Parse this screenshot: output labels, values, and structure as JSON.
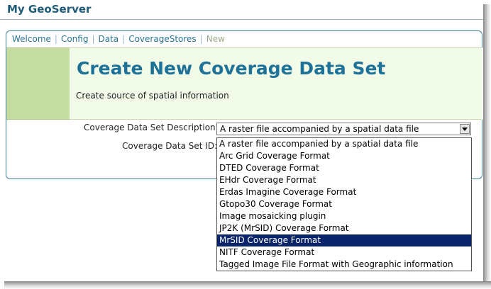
{
  "app": {
    "title": "My GeoServer"
  },
  "breadcrumb": {
    "items": [
      "Welcome",
      "Config",
      "Data",
      "CoverageStores"
    ],
    "current": "New"
  },
  "header": {
    "title": "Create New Coverage Data Set",
    "subtitle": "Create source of spatial information"
  },
  "form": {
    "description_label": "Coverage Data Set Description:",
    "id_label": "Coverage Data Set ID:",
    "select": {
      "value": "A raster file accompanied by a spatial data file",
      "options": [
        "A raster file accompanied by a spatial data file",
        "Arc Grid Coverage Format",
        "DTED Coverage Format",
        "EHdr Coverage Format",
        "Erdas Imagine Coverage Format",
        "Gtopo30 Coverage Format",
        "Image mosaicking plugin",
        "JP2K (MrSID) Coverage Format",
        "MrSID Coverage Format",
        "NITF Coverage Format",
        "Tagged Image File Format with Geographic information"
      ],
      "highlighted": "MrSID Coverage Format"
    }
  },
  "icons": {
    "dropdown_arrow": "chevron-down-icon"
  }
}
